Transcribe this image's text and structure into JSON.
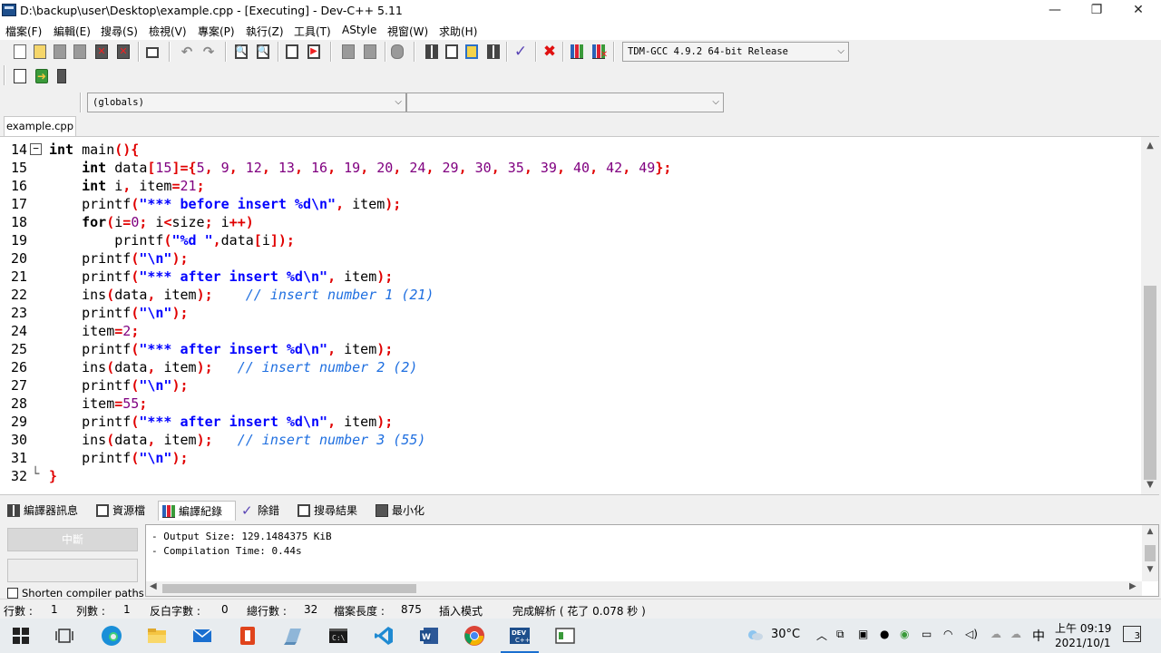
{
  "window": {
    "title": "D:\\backup\\user\\Desktop\\example.cpp - [Executing] - Dev-C++ 5.11",
    "minimize": "—",
    "maximize": "❐",
    "close": "✕"
  },
  "menu": [
    "檔案(F)",
    "編輯(E)",
    "搜尋(S)",
    "檢視(V)",
    "專案(P)",
    "執行(Z)",
    "工具(T)",
    "AStyle",
    "視窗(W)",
    "求助(H)"
  ],
  "toolbar": {
    "compiler": "TDM-GCC 4.9.2 64-bit Release",
    "class_combo": "(globals)",
    "member_combo": "",
    "icons": [
      "new-file-icon",
      "open-file-icon",
      "save-icon",
      "save-all-icon",
      "close-icon",
      "close-all-icon",
      "print-icon",
      "undo-icon",
      "redo-icon",
      "find-icon",
      "replace-icon",
      "goto-line-icon",
      "toggle-bookmark-icon",
      "unindent-icon",
      "indent-icon",
      "comment-icon",
      "compile-icon",
      "run-icon",
      "compile-run-icon",
      "rebuild-icon",
      "syntax-check-icon",
      "stop-icon",
      "profile-icon",
      "delete-profile-icon",
      "insert-icon",
      "toggle-icon",
      "goto-icon"
    ]
  },
  "editor": {
    "tab": "example.cpp",
    "lines": [
      {
        "no": "14",
        "fold": "−",
        "tokens": [
          [
            "kw",
            "int"
          ],
          [
            "id",
            " main"
          ],
          [
            "op",
            "(){"
          ]
        ]
      },
      {
        "no": "15",
        "tokens": [
          [
            "id",
            "    "
          ],
          [
            "kw",
            "int"
          ],
          [
            "id",
            " data"
          ],
          [
            "op",
            "["
          ],
          [
            "num",
            "15"
          ],
          [
            "op",
            "]={"
          ],
          [
            "num",
            "5"
          ],
          [
            "op",
            ", "
          ],
          [
            "num",
            "9"
          ],
          [
            "op",
            ", "
          ],
          [
            "num",
            "12"
          ],
          [
            "op",
            ", "
          ],
          [
            "num",
            "13"
          ],
          [
            "op",
            ", "
          ],
          [
            "num",
            "16"
          ],
          [
            "op",
            ", "
          ],
          [
            "num",
            "19"
          ],
          [
            "op",
            ", "
          ],
          [
            "num",
            "20"
          ],
          [
            "op",
            ", "
          ],
          [
            "num",
            "24"
          ],
          [
            "op",
            ", "
          ],
          [
            "num",
            "29"
          ],
          [
            "op",
            ", "
          ],
          [
            "num",
            "30"
          ],
          [
            "op",
            ", "
          ],
          [
            "num",
            "35"
          ],
          [
            "op",
            ", "
          ],
          [
            "num",
            "39"
          ],
          [
            "op",
            ", "
          ],
          [
            "num",
            "40"
          ],
          [
            "op",
            ", "
          ],
          [
            "num",
            "42"
          ],
          [
            "op",
            ", "
          ],
          [
            "num",
            "49"
          ],
          [
            "op",
            "};"
          ]
        ]
      },
      {
        "no": "16",
        "tokens": [
          [
            "id",
            "    "
          ],
          [
            "kw",
            "int"
          ],
          [
            "id",
            " i"
          ],
          [
            "op",
            ", "
          ],
          [
            "id",
            "item"
          ],
          [
            "op",
            "="
          ],
          [
            "num",
            "21"
          ],
          [
            "op",
            ";"
          ]
        ]
      },
      {
        "no": "17",
        "tokens": [
          [
            "id",
            "    printf"
          ],
          [
            "op",
            "("
          ],
          [
            "str",
            "\"*** before insert %d\\n\""
          ],
          [
            "op",
            ", "
          ],
          [
            "id",
            "item"
          ],
          [
            "op",
            ");"
          ]
        ]
      },
      {
        "no": "18",
        "tokens": [
          [
            "id",
            "    "
          ],
          [
            "kw",
            "for"
          ],
          [
            "op",
            "("
          ],
          [
            "id",
            "i"
          ],
          [
            "op",
            "="
          ],
          [
            "num",
            "0"
          ],
          [
            "op",
            "; "
          ],
          [
            "id",
            "i"
          ],
          [
            "op",
            "<"
          ],
          [
            "id",
            "size"
          ],
          [
            "op",
            "; "
          ],
          [
            "id",
            "i"
          ],
          [
            "op",
            "++)"
          ]
        ]
      },
      {
        "no": "19",
        "tokens": [
          [
            "id",
            "        printf"
          ],
          [
            "op",
            "("
          ],
          [
            "str",
            "\"%d \""
          ],
          [
            "op",
            ","
          ],
          [
            "id",
            "data"
          ],
          [
            "op",
            "["
          ],
          [
            "id",
            "i"
          ],
          [
            "op",
            "]);"
          ]
        ]
      },
      {
        "no": "20",
        "tokens": [
          [
            "id",
            "    printf"
          ],
          [
            "op",
            "("
          ],
          [
            "str",
            "\"\\n\""
          ],
          [
            "op",
            ");"
          ]
        ]
      },
      {
        "no": "21",
        "tokens": [
          [
            "id",
            "    printf"
          ],
          [
            "op",
            "("
          ],
          [
            "str",
            "\"*** after insert %d\\n\""
          ],
          [
            "op",
            ", "
          ],
          [
            "id",
            "item"
          ],
          [
            "op",
            ");"
          ]
        ]
      },
      {
        "no": "22",
        "tokens": [
          [
            "id",
            "    ins"
          ],
          [
            "op",
            "("
          ],
          [
            "id",
            "data"
          ],
          [
            "op",
            ", "
          ],
          [
            "id",
            "item"
          ],
          [
            "op",
            ");"
          ],
          [
            "id",
            "    "
          ],
          [
            "cmt",
            "// insert number 1 (21)"
          ]
        ]
      },
      {
        "no": "23",
        "tokens": [
          [
            "id",
            "    printf"
          ],
          [
            "op",
            "("
          ],
          [
            "str",
            "\"\\n\""
          ],
          [
            "op",
            ");"
          ]
        ]
      },
      {
        "no": "24",
        "tokens": [
          [
            "id",
            "    item"
          ],
          [
            "op",
            "="
          ],
          [
            "num",
            "2"
          ],
          [
            "op",
            ";"
          ]
        ]
      },
      {
        "no": "25",
        "tokens": [
          [
            "id",
            "    printf"
          ],
          [
            "op",
            "("
          ],
          [
            "str",
            "\"*** after insert %d\\n\""
          ],
          [
            "op",
            ", "
          ],
          [
            "id",
            "item"
          ],
          [
            "op",
            ");"
          ]
        ]
      },
      {
        "no": "26",
        "tokens": [
          [
            "id",
            "    ins"
          ],
          [
            "op",
            "("
          ],
          [
            "id",
            "data"
          ],
          [
            "op",
            ", "
          ],
          [
            "id",
            "item"
          ],
          [
            "op",
            ");"
          ],
          [
            "id",
            "   "
          ],
          [
            "cmt",
            "// insert number 2 (2)"
          ]
        ]
      },
      {
        "no": "27",
        "tokens": [
          [
            "id",
            "    printf"
          ],
          [
            "op",
            "("
          ],
          [
            "str",
            "\"\\n\""
          ],
          [
            "op",
            ");"
          ]
        ]
      },
      {
        "no": "28",
        "tokens": [
          [
            "id",
            "    item"
          ],
          [
            "op",
            "="
          ],
          [
            "num",
            "55"
          ],
          [
            "op",
            ";"
          ]
        ]
      },
      {
        "no": "29",
        "tokens": [
          [
            "id",
            "    printf"
          ],
          [
            "op",
            "("
          ],
          [
            "str",
            "\"*** after insert %d\\n\""
          ],
          [
            "op",
            ", "
          ],
          [
            "id",
            "item"
          ],
          [
            "op",
            ");"
          ]
        ]
      },
      {
        "no": "30",
        "tokens": [
          [
            "id",
            "    ins"
          ],
          [
            "op",
            "("
          ],
          [
            "id",
            "data"
          ],
          [
            "op",
            ", "
          ],
          [
            "id",
            "item"
          ],
          [
            "op",
            ");"
          ],
          [
            "id",
            "   "
          ],
          [
            "cmt",
            "// insert number 3 (55)"
          ]
        ]
      },
      {
        "no": "31",
        "tokens": [
          [
            "id",
            "    printf"
          ],
          [
            "op",
            "("
          ],
          [
            "str",
            "\"\\n\""
          ],
          [
            "op",
            ");"
          ]
        ]
      },
      {
        "no": "32",
        "fold": "└",
        "tokens": [
          [
            "op",
            "}"
          ]
        ]
      }
    ]
  },
  "bottom": {
    "tabs": [
      "編譯器訊息",
      "資源檔",
      "編譯紀錄",
      "除錯",
      "搜尋結果",
      "最小化"
    ],
    "active_tab": 2,
    "abort_button": "中斷",
    "log": [
      "- Output Size: 129.1484375 KiB",
      "- Compilation Time: 0.44s"
    ],
    "shorten_label": "Shorten compiler paths"
  },
  "status": {
    "row_label": "行數 :",
    "row": "1",
    "col_label": "列數 :",
    "col": "1",
    "sel_label": "反白字數 :",
    "sel": "0",
    "lines_label": "總行數 :",
    "lines": "32",
    "len_label": "檔案長度 :",
    "len": "875",
    "mode": "插入模式",
    "parse": "完成解析 ( 花了 0.078 秒 )"
  },
  "taskbar": {
    "weather": "30°C",
    "ime": "中",
    "time": "上午 09:19",
    "date": "2021/10/1",
    "notifications": "3"
  }
}
